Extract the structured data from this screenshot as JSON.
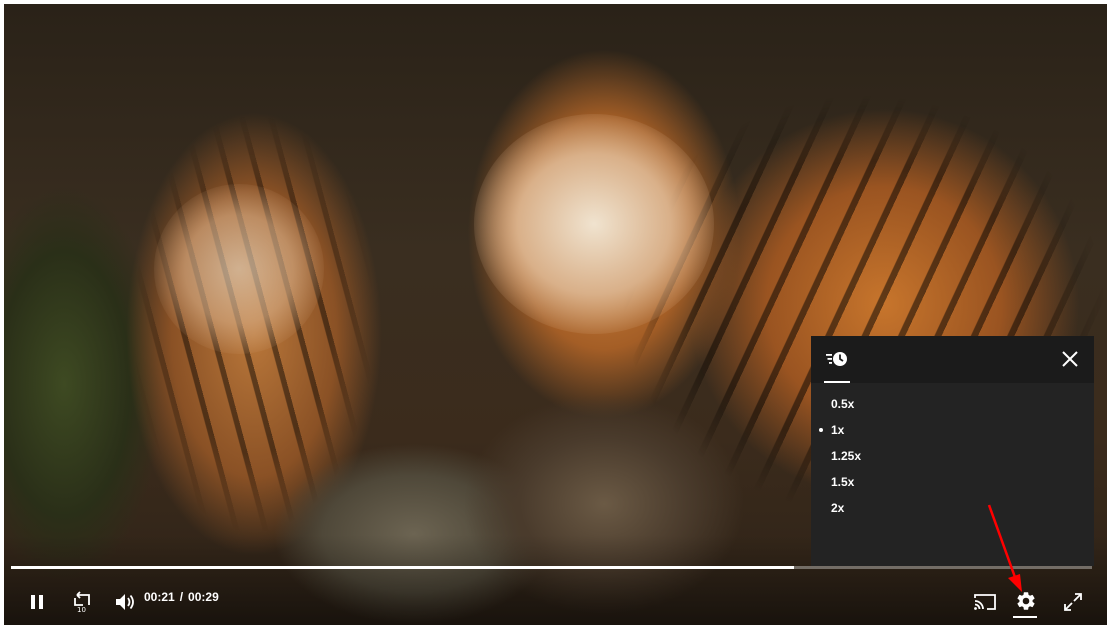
{
  "video": {
    "current_time": "00:21",
    "time_separator": "/",
    "duration": "00:29",
    "progress_fraction": 0.724
  },
  "speed_menu": {
    "options": [
      {
        "label": "0.5x",
        "selected": false
      },
      {
        "label": "1x",
        "selected": true
      },
      {
        "label": "1.25x",
        "selected": false
      },
      {
        "label": "1.5x",
        "selected": false
      },
      {
        "label": "2x",
        "selected": false
      }
    ]
  },
  "controls": {
    "left": [
      "pause-icon",
      "rewind-10-icon",
      "volume-icon"
    ],
    "right": [
      "cast-icon",
      "gear-icon",
      "fullscreen-icon"
    ]
  },
  "colors": {
    "annotation_arrow": "#ff0000",
    "menu_bg": "#232323",
    "menu_header_bg": "#1b1b1b"
  }
}
